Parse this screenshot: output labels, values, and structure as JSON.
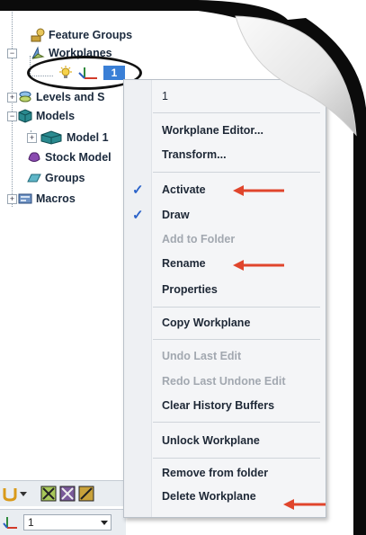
{
  "tree": {
    "feature_groups": "Feature Groups",
    "workplanes": "Workplanes",
    "selected_workplane": "1",
    "levels_and_sets": "Levels and S",
    "models": "Models",
    "model_1": "Model 1",
    "stock_model": "Stock Model",
    "groups": "Groups",
    "macros": "Macros"
  },
  "context_menu": {
    "header": "1",
    "items": [
      {
        "label": "Workplane Editor...",
        "enabled": true,
        "checked": false
      },
      {
        "label": "Transform...",
        "enabled": true,
        "checked": false
      },
      {
        "label": "Activate",
        "enabled": true,
        "checked": true
      },
      {
        "label": "Draw",
        "enabled": true,
        "checked": true
      },
      {
        "label": "Add to Folder",
        "enabled": false,
        "checked": false
      },
      {
        "label": "Rename",
        "enabled": true,
        "checked": false
      },
      {
        "label": "Properties",
        "enabled": true,
        "checked": false
      },
      {
        "label": "Copy Workplane",
        "enabled": true,
        "checked": false
      },
      {
        "label": "Undo Last Edit",
        "enabled": false,
        "checked": false
      },
      {
        "label": "Redo Last Undone Edit",
        "enabled": false,
        "checked": false
      },
      {
        "label": "Clear History Buffers",
        "enabled": true,
        "checked": false
      },
      {
        "label": "Unlock Workplane",
        "enabled": true,
        "checked": false
      },
      {
        "label": "Remove from folder",
        "enabled": true,
        "checked": false
      },
      {
        "label": "Delete Workplane",
        "enabled": true,
        "checked": false
      }
    ]
  },
  "bottom_toolbar": {
    "workplane_combo_value": "1"
  },
  "annotations": {
    "arrow_color": "#e0452c",
    "circle_color": "#111111"
  },
  "colors": {
    "selection_blue": "#3a7fd6",
    "check_blue": "#2b63c9"
  }
}
